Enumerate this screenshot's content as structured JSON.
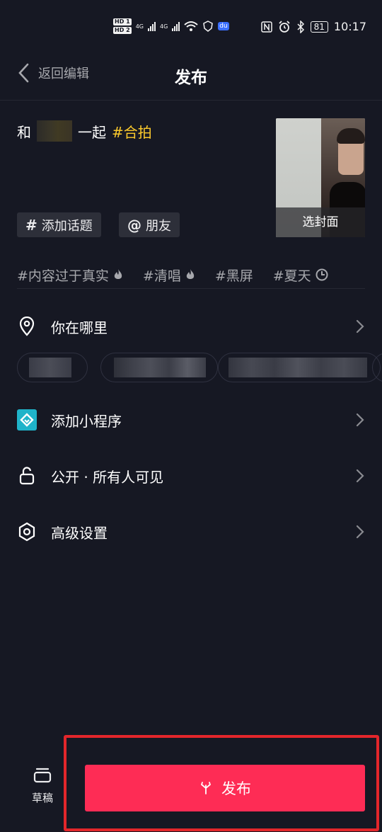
{
  "status_bar": {
    "hd1": "HD 1",
    "hd2": "HD 2",
    "sig1": "4G",
    "sig2": "4G",
    "du": "du",
    "battery": "81",
    "time": "10:17"
  },
  "nav": {
    "back_label": "返回编辑",
    "title": "发布"
  },
  "caption": {
    "prefix": "和",
    "middle": "一起",
    "tag": "#合拍"
  },
  "cover": {
    "label": "选封面"
  },
  "chips": {
    "topic": "添加话题",
    "friend": "朋友"
  },
  "hashtags": [
    {
      "label": "#内容过于真实",
      "icon": "flame-icon"
    },
    {
      "label": "#清唱",
      "icon": "flame-icon"
    },
    {
      "label": "#黑屏",
      "icon": ""
    },
    {
      "label": "#夏天",
      "icon": "clock-icon"
    }
  ],
  "rows": {
    "location": "你在哪里",
    "mini_program": "添加小程序",
    "privacy": "公开 · 所有人可见",
    "advanced": "高级设置"
  },
  "bottom": {
    "draft_label": "草稿",
    "publish_label": "发布"
  },
  "colors": {
    "background": "#161823",
    "accent": "#fe2c55",
    "tag_highlight": "#fcca2c",
    "highlight_box": "#e3262b"
  }
}
